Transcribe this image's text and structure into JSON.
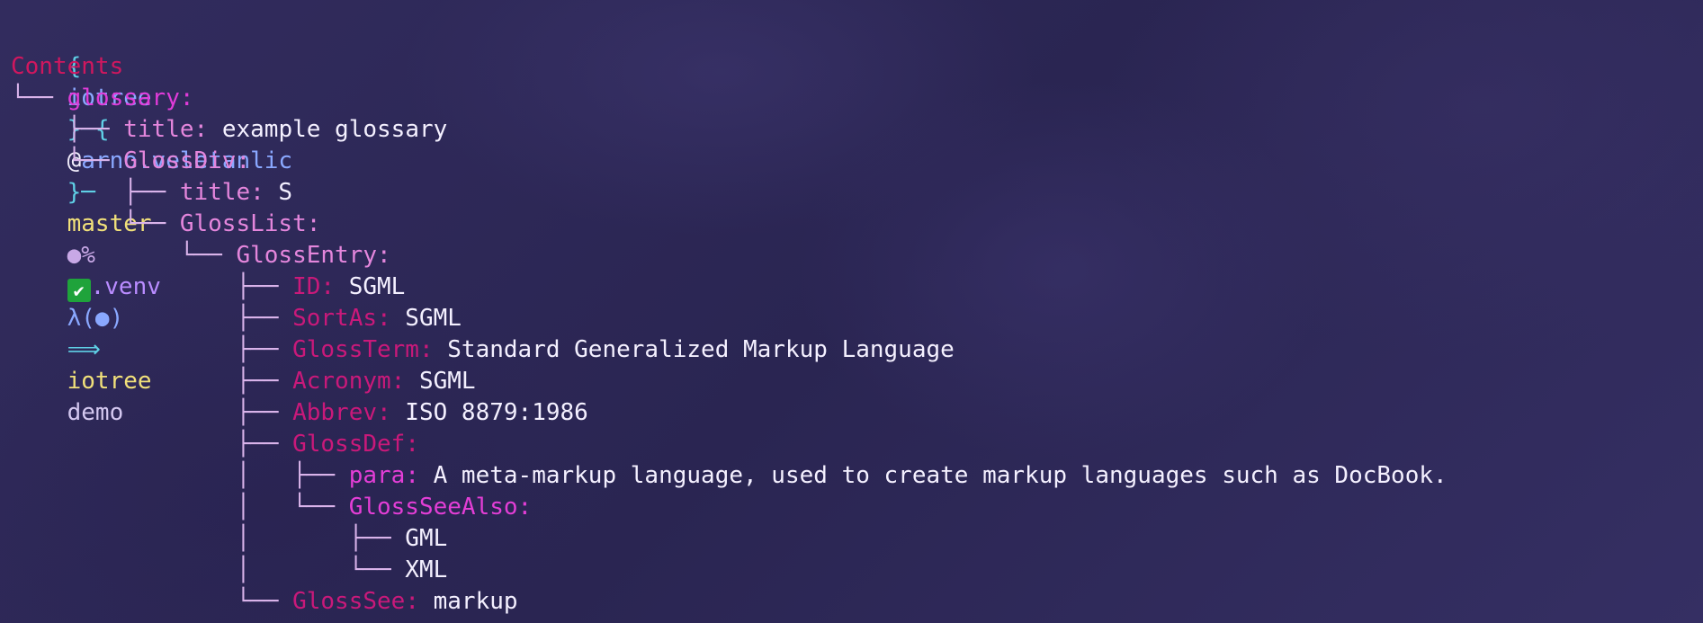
{
  "prompt": {
    "open_brace": "{",
    "app": "iotree",
    "close_brace": "}",
    "sep1": "─{",
    "at": "@",
    "user": "arno.veletanlic",
    "close2": "}─",
    "branch": "master",
    "git_status": "●%",
    "check": "✔",
    "venv": ".venv",
    "lambda": "λ(●)",
    "arrow": "⟹",
    "cmd": "iotree",
    "arg": "demo"
  },
  "heading": "Contents",
  "tree": [
    {
      "indent": "",
      "guide": "└── ",
      "key": "glossary",
      "sep": ":",
      "value": "",
      "style": "k-root"
    },
    {
      "indent": "    ",
      "guide": "├── ",
      "key": "title",
      "sep": ":",
      "value": " example glossary",
      "style": "k-mid"
    },
    {
      "indent": "    ",
      "guide": "└── ",
      "key": "GlossDiv",
      "sep": ":",
      "value": "",
      "style": "k-mid"
    },
    {
      "indent": "        ",
      "guide": "├── ",
      "key": "title",
      "sep": ":",
      "value": " S",
      "style": "k-mid"
    },
    {
      "indent": "        ",
      "guide": "└── ",
      "key": "GlossList",
      "sep": ":",
      "value": "",
      "style": "k-mid"
    },
    {
      "indent": "            ",
      "guide": "└── ",
      "key": "GlossEntry",
      "sep": ":",
      "value": "",
      "style": "k-mid"
    },
    {
      "indent": "                ",
      "guide": "├── ",
      "key": "ID",
      "sep": ":",
      "value": " SGML",
      "style": "k-deep"
    },
    {
      "indent": "                ",
      "guide": "├── ",
      "key": "SortAs",
      "sep": ":",
      "value": " SGML",
      "style": "k-deep"
    },
    {
      "indent": "                ",
      "guide": "├── ",
      "key": "GlossTerm",
      "sep": ":",
      "value": " Standard Generalized Markup Language",
      "style": "k-deep"
    },
    {
      "indent": "                ",
      "guide": "├── ",
      "key": "Acronym",
      "sep": ":",
      "value": " SGML",
      "style": "k-deep"
    },
    {
      "indent": "                ",
      "guide": "├── ",
      "key": "Abbrev",
      "sep": ":",
      "value": " ISO 8879:1986",
      "style": "k-deep"
    },
    {
      "indent": "                ",
      "guide": "├── ",
      "key": "GlossDef",
      "sep": ":",
      "value": "",
      "style": "k-deep"
    },
    {
      "indent": "                │   ",
      "guide": "├── ",
      "key": "para",
      "sep": ":",
      "value": " A meta-markup language, used to create markup languages such as DocBook.",
      "style": "k-para"
    },
    {
      "indent": "                │   ",
      "guide": "└── ",
      "key": "GlossSeeAlso",
      "sep": ":",
      "value": "",
      "style": "k-para"
    },
    {
      "indent": "                │       ",
      "guide": "├── ",
      "key": "",
      "sep": "",
      "value": "GML",
      "style": "k-para"
    },
    {
      "indent": "                │       ",
      "guide": "└── ",
      "key": "",
      "sep": "",
      "value": "XML",
      "style": "k-para"
    },
    {
      "indent": "                ",
      "guide": "└── ",
      "key": "GlossSee",
      "sep": ":",
      "value": " markup",
      "style": "k-deep"
    }
  ]
}
